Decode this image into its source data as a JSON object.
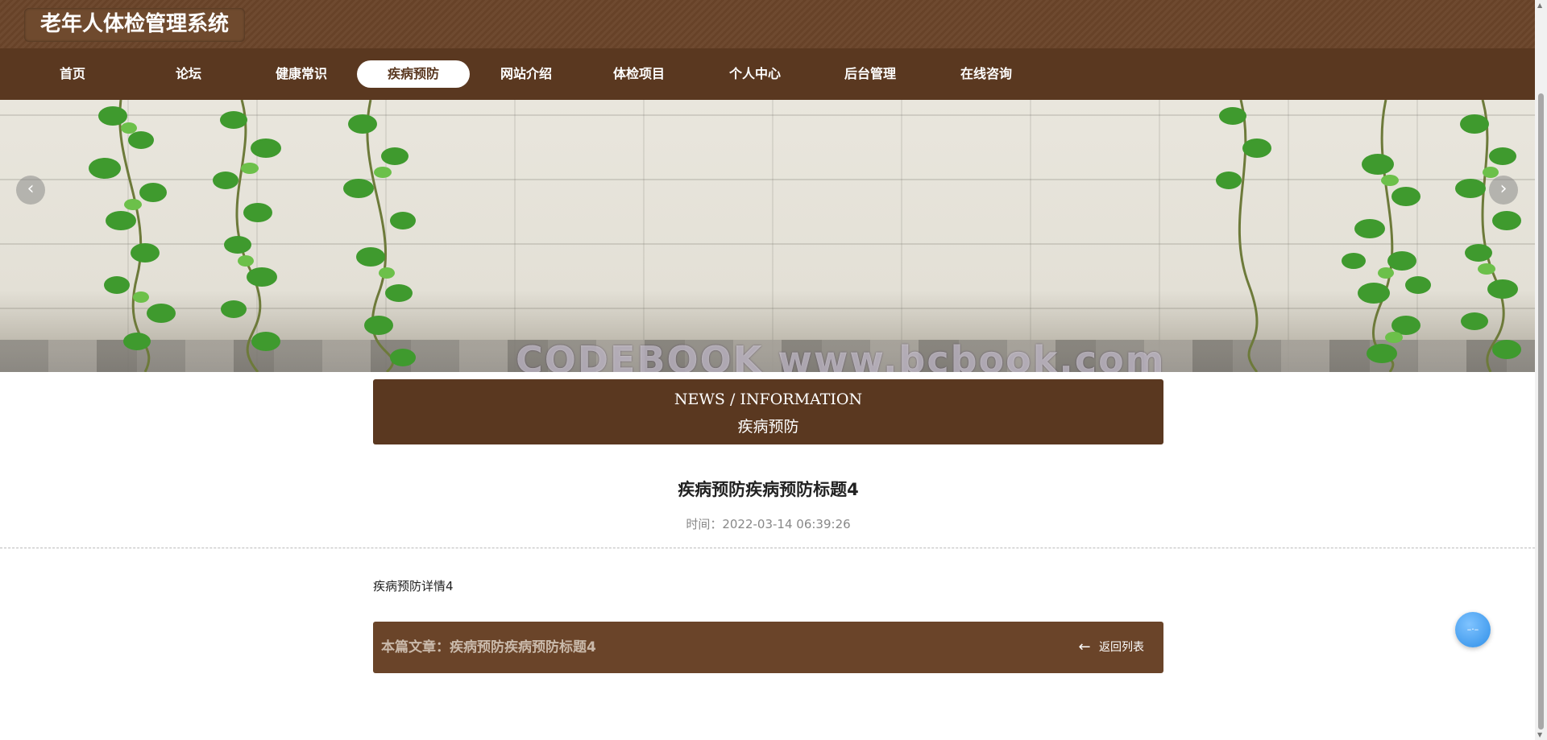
{
  "header": {
    "site_title": "老年人体检管理系统"
  },
  "nav": {
    "items": [
      {
        "label": "首页"
      },
      {
        "label": "论坛"
      },
      {
        "label": "健康常识"
      },
      {
        "label": "疾病预防",
        "active": true
      },
      {
        "label": "网站介绍"
      },
      {
        "label": "体检项目"
      },
      {
        "label": "个人中心"
      },
      {
        "label": "后台管理"
      },
      {
        "label": "在线咨询"
      }
    ]
  },
  "banner": {
    "watermark": "CODEBOOK www.bcbook.com",
    "prev_icon": "chevron-left-icon",
    "next_icon": "chevron-right-icon"
  },
  "section": {
    "en_title": "NEWS / INFORMATION",
    "cn_title": "疾病预防"
  },
  "article": {
    "title": "疾病预防疾病预防标题4",
    "meta": "时间：2022-03-14 06:39:26",
    "body": "疾病预防详情4"
  },
  "footer": {
    "current_article": "本篇文章：疾病预防疾病预防标题4",
    "back_label": "返回列表",
    "back_icon": "arrow-left-icon"
  },
  "colors": {
    "primary": "#6a4429",
    "nav_bg": "#5a3820",
    "float_button": "#2f8fe8"
  }
}
